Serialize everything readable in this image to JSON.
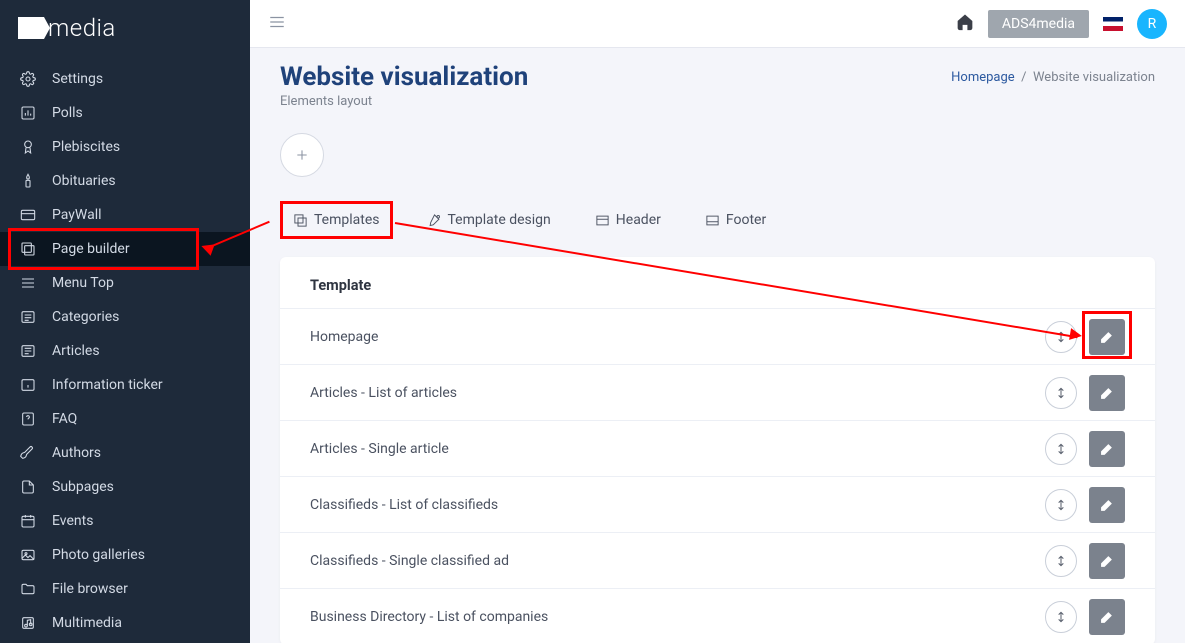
{
  "brand": {
    "name": "media"
  },
  "sidebar": {
    "items": [
      {
        "label": "Settings"
      },
      {
        "label": "Polls"
      },
      {
        "label": "Plebiscites"
      },
      {
        "label": "Obituaries"
      },
      {
        "label": "PayWall"
      },
      {
        "label": "Page builder"
      },
      {
        "label": "Menu Top"
      },
      {
        "label": "Categories"
      },
      {
        "label": "Articles"
      },
      {
        "label": "Information ticker"
      },
      {
        "label": "FAQ"
      },
      {
        "label": "Authors"
      },
      {
        "label": "Subpages"
      },
      {
        "label": "Events"
      },
      {
        "label": "Photo galleries"
      },
      {
        "label": "File browser"
      },
      {
        "label": "Multimedia"
      }
    ]
  },
  "topbar": {
    "tenant": "ADS4media",
    "avatar": "R"
  },
  "page": {
    "title": "Website visualization",
    "subtitle": "Elements layout"
  },
  "breadcrumb": {
    "parent": "Homepage",
    "current": "Website visualization",
    "sep": "/"
  },
  "tabs": [
    {
      "label": "Templates"
    },
    {
      "label": "Template design"
    },
    {
      "label": "Header"
    },
    {
      "label": "Footer"
    }
  ],
  "table": {
    "header": "Template",
    "rows": [
      {
        "name": "Homepage"
      },
      {
        "name": "Articles - List of articles"
      },
      {
        "name": "Articles - Single article"
      },
      {
        "name": "Classifieds - List of classifieds"
      },
      {
        "name": "Classifieds - Single classified ad"
      },
      {
        "name": "Business Directory - List of companies"
      }
    ]
  }
}
